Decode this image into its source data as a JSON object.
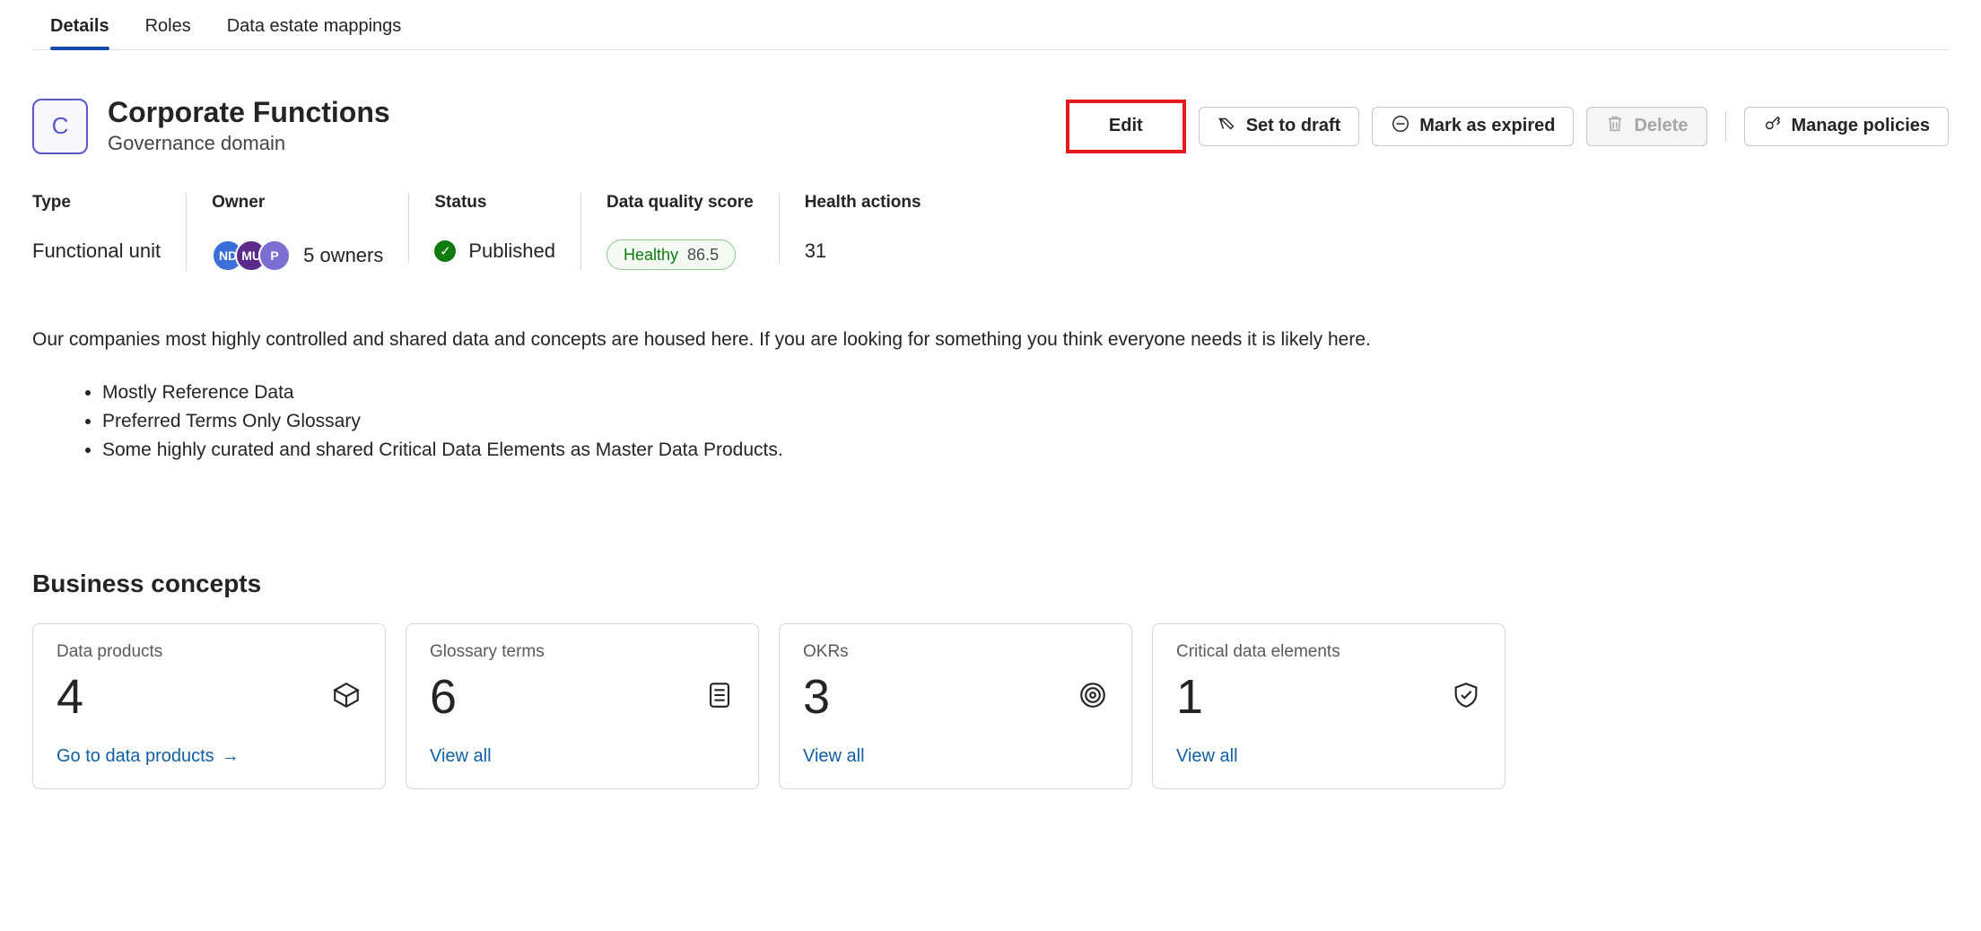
{
  "tabs": {
    "details": "Details",
    "roles": "Roles",
    "mappings": "Data estate mappings"
  },
  "header": {
    "badge_letter": "C",
    "title": "Corporate Functions",
    "subtitle": "Governance domain"
  },
  "actions": {
    "edit": "Edit",
    "set_to_draft": "Set to draft",
    "mark_expired": "Mark as expired",
    "delete": "Delete",
    "manage_policies": "Manage policies"
  },
  "meta": {
    "type": {
      "label": "Type",
      "value": "Functional unit"
    },
    "owner": {
      "label": "Owner",
      "avatars": [
        {
          "initials": "ND",
          "color": "#3b6fd8"
        },
        {
          "initials": "MU",
          "color": "#5b2a8c"
        },
        {
          "initials": "P",
          "color": "#7b6fd1"
        }
      ],
      "count_text": "5 owners"
    },
    "status": {
      "label": "Status",
      "value": "Published"
    },
    "quality": {
      "label": "Data quality score",
      "pill_label": "Healthy",
      "score": "86.5"
    },
    "health_actions": {
      "label": "Health actions",
      "value": "31"
    }
  },
  "description": {
    "paragraph": "Our companies most highly controlled and shared data and concepts are housed here. If you are looking for something you think everyone needs it is likely here.",
    "bullets": [
      "Mostly Reference Data",
      "Preferred Terms Only Glossary",
      "Some highly curated and shared Critical Data Elements as Master Data Products."
    ]
  },
  "section_heading": "Business concepts",
  "cards": {
    "data_products": {
      "label": "Data products",
      "count": "4",
      "link": "Go to data products"
    },
    "glossary_terms": {
      "label": "Glossary terms",
      "count": "6",
      "link": "View all"
    },
    "okrs": {
      "label": "OKRs",
      "count": "3",
      "link": "View all"
    },
    "cde": {
      "label": "Critical data elements",
      "count": "1",
      "link": "View all"
    }
  }
}
